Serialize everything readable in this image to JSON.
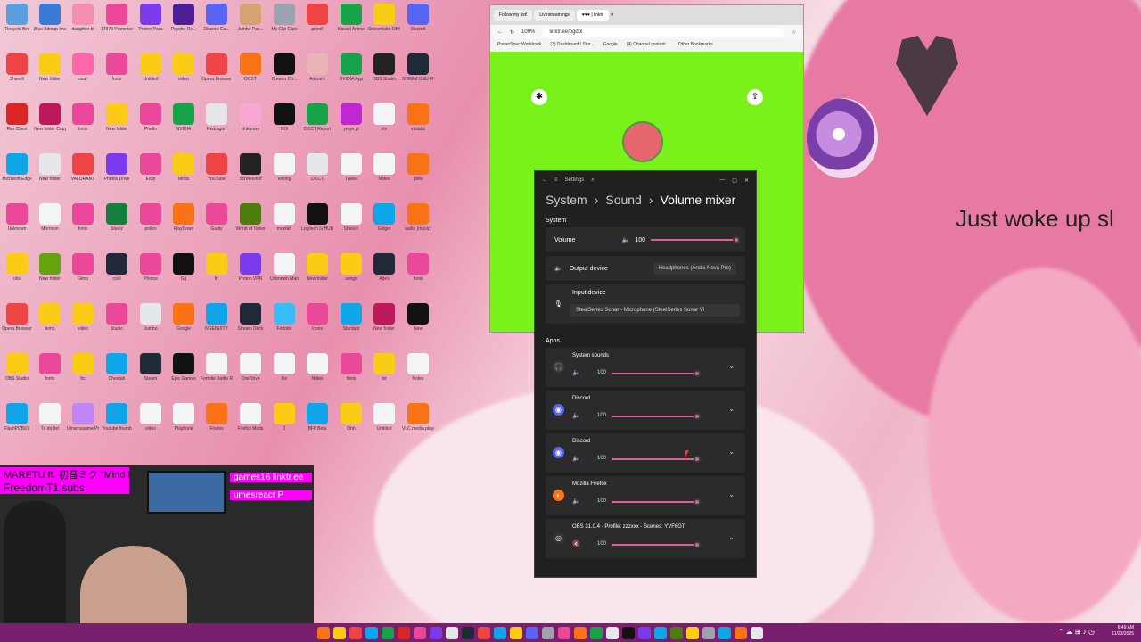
{
  "wallpaper": {
    "caption": "Just woke up sl"
  },
  "desktop_icons": [
    {
      "label": "Recycle Bin",
      "color": "#5aa0e0"
    },
    {
      "label": "Blue Bitmap Image",
      "color": "#3a7bd5"
    },
    {
      "label": "daughter bl",
      "color": "#f48fb1"
    },
    {
      "label": "17979 Promoted",
      "color": "#ec4899"
    },
    {
      "label": "Proton Pass",
      "color": "#7c3aed"
    },
    {
      "label": "Psycho Re...",
      "color": "#4c1d95"
    },
    {
      "label": "Discord Ca...",
      "color": "#5865f2"
    },
    {
      "label": "Jumbo Pac...",
      "color": "#d4a373"
    },
    {
      "label": "My Clip Clips",
      "color": "#9ca3af"
    },
    {
      "label": "picroll",
      "color": "#ef4444"
    },
    {
      "label": "Kawaii Anime",
      "color": "#16a34a"
    },
    {
      "label": "Streamlabs OBS",
      "color": "#facc15"
    },
    {
      "label": "Discord",
      "color": "#5865f2"
    },
    {
      "label": "ShareX",
      "color": "#ef4444"
    },
    {
      "label": "New folder",
      "color": "#facc15"
    },
    {
      "label": "osu!",
      "color": "#ff66aa"
    },
    {
      "label": "fonts",
      "color": "#ec4899"
    },
    {
      "label": "Untitled",
      "color": "#facc15"
    },
    {
      "label": "video",
      "color": "#facc15"
    },
    {
      "label": "Opera Browser",
      "color": "#ef4444"
    },
    {
      "label": "OCCT",
      "color": "#f97316"
    },
    {
      "label": "Creator Ch...",
      "color": "#111111"
    },
    {
      "label": "Anime's",
      "color": "#e8b4b8"
    },
    {
      "label": "NVIDIA App",
      "color": "#16a34a"
    },
    {
      "label": "OBS Studio",
      "color": "#222222"
    },
    {
      "label": "STREM OSU FIRFOX",
      "color": "#1f2937"
    },
    {
      "label": "Riot Client",
      "color": "#dc2626"
    },
    {
      "label": "New folder Copy",
      "color": "#be185d"
    },
    {
      "label": "fonts",
      "color": "#ec4899"
    },
    {
      "label": "New folder",
      "color": "#facc15"
    },
    {
      "label": "Phello",
      "color": "#ec4899"
    },
    {
      "label": "NVIDIA",
      "color": "#16a34a"
    },
    {
      "label": "Redragon",
      "color": "#e5e7eb"
    },
    {
      "label": "Unknown",
      "color": "#f9a8d4"
    },
    {
      "label": "NDI",
      "color": "#111111"
    },
    {
      "label": "OCCT Report",
      "color": "#16a34a"
    },
    {
      "label": "ye ye.pl",
      "color": "#c026d3"
    },
    {
      "label": "vtx",
      "color": "#f3f4f6"
    },
    {
      "label": "vtxtabs",
      "color": "#f97316"
    },
    {
      "label": "Microsoft Edge",
      "color": "#0ea5e9"
    },
    {
      "label": "New folder",
      "color": "#e5e7eb"
    },
    {
      "label": "VALORANT",
      "color": "#ef4444"
    },
    {
      "label": "Photos Drive",
      "color": "#7c3aed"
    },
    {
      "label": "Eclip",
      "color": "#ec4899"
    },
    {
      "label": "Mods",
      "color": "#facc15"
    },
    {
      "label": "YouTube",
      "color": "#ef4444"
    },
    {
      "label": "Screenshot",
      "color": "#222222"
    },
    {
      "label": "editing",
      "color": "#f3f4f6"
    },
    {
      "label": "OCCT",
      "color": "#e5e7eb"
    },
    {
      "label": "Trailer",
      "color": "#f3f4f6"
    },
    {
      "label": "Notes",
      "color": "#f3f4f6"
    },
    {
      "label": "pixel",
      "color": "#f97316"
    },
    {
      "label": "Unknown",
      "color": "#ec4899"
    },
    {
      "label": "Morrison",
      "color": "#f3f4f6"
    },
    {
      "label": "fonts",
      "color": "#ec4899"
    },
    {
      "label": "Steelz",
      "color": "#15803d"
    },
    {
      "label": "pollen",
      "color": "#ec4899"
    },
    {
      "label": "PlayDown",
      "color": "#f97316"
    },
    {
      "label": "Gudly",
      "color": "#ec4899"
    },
    {
      "label": "World of Tanks",
      "color": "#4d7c0f"
    },
    {
      "label": "moolah",
      "color": "#f3f4f6"
    },
    {
      "label": "Logitech G HUB",
      "color": "#111111"
    },
    {
      "label": "ShareX",
      "color": "#f3f4f6"
    },
    {
      "label": "Gidget",
      "color": "#0ea5e9"
    },
    {
      "label": "audio (music)",
      "color": "#f97316"
    },
    {
      "label": "obs",
      "color": "#facc15"
    },
    {
      "label": "New folder",
      "color": "#65a30d"
    },
    {
      "label": "Gimp",
      "color": "#ec4899"
    },
    {
      "label": "cool",
      "color": "#1f2937"
    },
    {
      "label": "Photos",
      "color": "#ec4899"
    },
    {
      "label": "Gg",
      "color": "#111111"
    },
    {
      "label": "fn",
      "color": "#facc15"
    },
    {
      "label": "Proton VPN",
      "color": "#7c3aed"
    },
    {
      "label": "Unknown Man",
      "color": "#f3f4f6"
    },
    {
      "label": "New folder",
      "color": "#facc15"
    },
    {
      "label": "songs",
      "color": "#facc15"
    },
    {
      "label": "Apex",
      "color": "#1f2937"
    },
    {
      "label": "fonts",
      "color": "#ec4899"
    },
    {
      "label": "Opera Browser",
      "color": "#ef4444"
    },
    {
      "label": "temp",
      "color": "#facc15"
    },
    {
      "label": "video",
      "color": "#facc15"
    },
    {
      "label": "Studio",
      "color": "#ec4899"
    },
    {
      "label": "Jumbo",
      "color": "#e5e7eb"
    },
    {
      "label": "Google",
      "color": "#f97316"
    },
    {
      "label": "NGENUITY",
      "color": "#0ea5e9"
    },
    {
      "label": "Stream Deck",
      "color": "#1f2937"
    },
    {
      "label": "Fortnite",
      "color": "#38bdf8"
    },
    {
      "label": "Icons",
      "color": "#ec4899"
    },
    {
      "label": "Stardust",
      "color": "#0ea5e9"
    },
    {
      "label": "New folder",
      "color": "#be185d"
    },
    {
      "label": "New",
      "color": "#111111"
    },
    {
      "label": "OBS Studio",
      "color": "#facc15"
    },
    {
      "label": "fonts",
      "color": "#ec4899"
    },
    {
      "label": "frc",
      "color": "#facc15"
    },
    {
      "label": "Cheetah",
      "color": "#0ea5e9"
    },
    {
      "label": "Steam",
      "color": "#1f2937"
    },
    {
      "label": "Epic Games",
      "color": "#111111"
    },
    {
      "label": "Fortnite Battle Royale",
      "color": "#f3f4f6"
    },
    {
      "label": "OneDrive",
      "color": "#f3f4f6"
    },
    {
      "label": "file",
      "color": "#f3f4f6"
    },
    {
      "label": "Notes",
      "color": "#f3f4f6"
    },
    {
      "label": "fonts",
      "color": "#ec4899"
    },
    {
      "label": "txt",
      "color": "#facc15"
    },
    {
      "label": "Notes",
      "color": "#f3f4f6"
    },
    {
      "label": "FlashPCBXX",
      "color": "#0ea5e9"
    },
    {
      "label": "To do list",
      "color": "#f3f4f6"
    },
    {
      "label": "Umamusume Pretty Derby",
      "color": "#c084fc"
    },
    {
      "label": "Youtube thumb",
      "color": "#0ea5e9"
    },
    {
      "label": "video",
      "color": "#f3f4f6"
    },
    {
      "label": "Playbook",
      "color": "#f3f4f6"
    },
    {
      "label": "Firefox",
      "color": "#f97316"
    },
    {
      "label": "Firefox Mods",
      "color": "#f3f4f6"
    },
    {
      "label": "2",
      "color": "#facc15"
    },
    {
      "label": "BF6 Beta",
      "color": "#0ea5e9"
    },
    {
      "label": "Ohh",
      "color": "#facc15"
    },
    {
      "label": "Untitled",
      "color": "#f3f4f6"
    },
    {
      "label": "VLC media player",
      "color": "#f97316"
    }
  ],
  "browser": {
    "tabs": [
      "Follow my list!",
      "Livestreamings",
      "♥♥♥ | linktr",
      "✕"
    ],
    "zoom": "100%",
    "url": "linktr.ee/pgdol",
    "bookmarks": [
      "PowerSpec Workbook",
      "(3) Dashboard / Stor...",
      "Google",
      "(4) Channel content...",
      "Other Bookmarks"
    ]
  },
  "settings": {
    "window_title": "Settings",
    "breadcrumb": [
      "System",
      "Sound",
      "Volume mixer"
    ],
    "section_system": "System",
    "volume_label": "Volume",
    "volume_value": "100",
    "volume_level": 1.0,
    "output_label": "Output device",
    "output_value": "Headphones (Arctis Nova Pro)",
    "input_label": "Input device",
    "input_value": "SteelSeries Sonar - Microphone (SteelSeries Sonar Vi",
    "section_apps": "Apps",
    "apps": [
      {
        "name": "System sounds",
        "value": "100",
        "level": 1.0,
        "icon": "headphones-icon",
        "glyph": "🎧",
        "color": "#3a3a3a",
        "muted": false
      },
      {
        "name": "Discord",
        "value": "100",
        "level": 1.0,
        "icon": "discord-icon",
        "glyph": "◉",
        "color": "#5865f2",
        "muted": false
      },
      {
        "name": "Discord",
        "value": "100",
        "level": 1.0,
        "icon": "discord-icon",
        "glyph": "◉",
        "color": "#5865f2",
        "muted": false
      },
      {
        "name": "Mozilla Firefox",
        "value": "100",
        "level": 1.0,
        "icon": "firefox-icon",
        "glyph": "◐",
        "color": "#f97316",
        "muted": false
      },
      {
        "name": "OBS 31.0.4 - Profile: zzzxxx - Scenes: YVF6GT",
        "value": "100",
        "level": 1.0,
        "icon": "obs-icon",
        "glyph": "◎",
        "color": "#333333",
        "muted": true
      }
    ]
  },
  "overlay": {
    "song_title": "MARETU ft. 初音ミク \"Mind Bro",
    "sub_goal": "FreedomT1 subs",
    "link_line1": "games16 linktr.ee",
    "link_line2": "umesreact P"
  },
  "taskbar": {
    "icon_colors": [
      "#f97316",
      "#facc15",
      "#ef4444",
      "#0ea5e9",
      "#16a34a",
      "#dc2626",
      "#ec4899",
      "#7c3aed",
      "#e5e7eb",
      "#1f2937",
      "#ef4444",
      "#0ea5e9",
      "#facc15",
      "#5865f2",
      "#9ca3af",
      "#ec4899",
      "#f97316",
      "#16a34a",
      "#e5e7eb",
      "#111111",
      "#7c3aed",
      "#0ea5e9",
      "#4d7c0f",
      "#facc15",
      "#9ca3af",
      "#0ea5e9",
      "#f97316",
      "#e5e7eb"
    ],
    "time": "6:49 AM",
    "date": "11/23/2025",
    "tray_glyphs": "⌃ ☁ ⊞ ♪ ◷"
  }
}
